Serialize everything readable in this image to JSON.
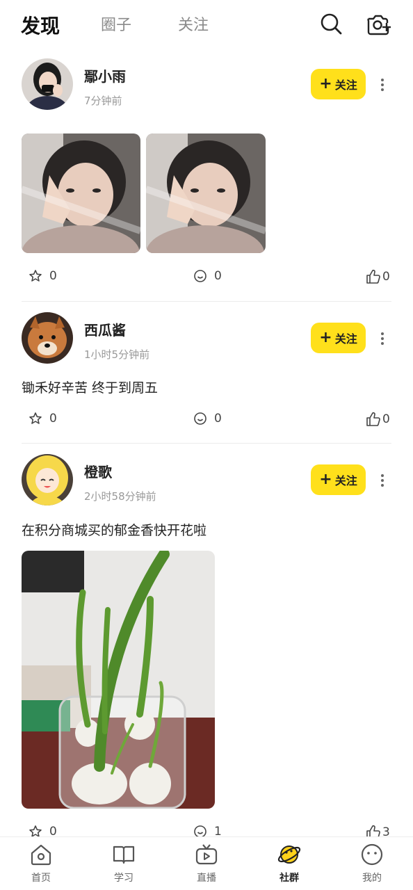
{
  "header": {
    "tabs": [
      {
        "label": "发现",
        "active": true
      },
      {
        "label": "圈子",
        "active": false
      },
      {
        "label": "关注",
        "active": false
      }
    ],
    "icons": [
      "search-icon",
      "camera-add-icon"
    ]
  },
  "follow_label": "关注",
  "posts": [
    {
      "username": "鄢小雨",
      "time": "7分钟前",
      "text": "",
      "photos": 2,
      "stars": "0",
      "comments": "0",
      "likes": "0"
    },
    {
      "username": "西瓜酱",
      "time": "1小时5分钟前",
      "text": "锄禾好辛苦 终于到周五",
      "photos": 0,
      "stars": "0",
      "comments": "0",
      "likes": "0"
    },
    {
      "username": "橙歌",
      "time": "2小时58分钟前",
      "text": "在积分商城买的郁金香快开花啦",
      "photos": 1,
      "stars": "0",
      "comments": "1",
      "likes": "3"
    }
  ],
  "bottom_nav": [
    {
      "label": "首页",
      "icon": "home-icon",
      "active": false
    },
    {
      "label": "学习",
      "icon": "book-icon",
      "active": false
    },
    {
      "label": "直播",
      "icon": "live-tv-icon",
      "active": false
    },
    {
      "label": "社群",
      "icon": "planet-icon",
      "active": true
    },
    {
      "label": "我的",
      "icon": "face-icon",
      "active": false
    }
  ],
  "colors": {
    "accent": "#ffe01b",
    "text": "#222222",
    "muted": "#999999"
  }
}
